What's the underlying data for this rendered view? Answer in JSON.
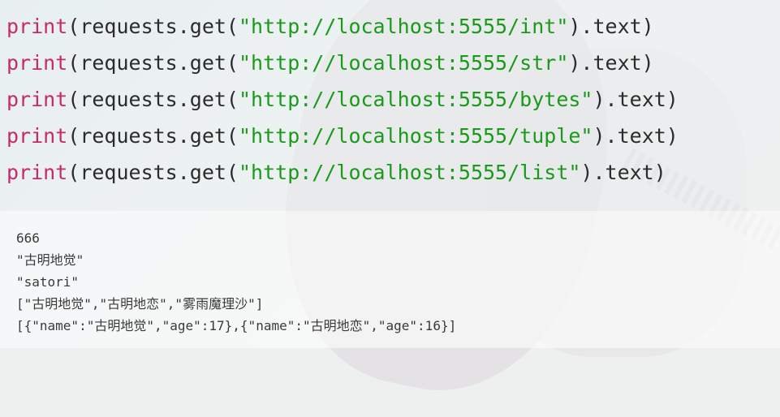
{
  "code": {
    "lines": [
      {
        "fn": "print",
        "pre": "(requests.get(",
        "url": "\"http://localhost:5555/int\"",
        "post": ").text)"
      },
      {
        "fn": "print",
        "pre": "(requests.get(",
        "url": "\"http://localhost:5555/str\"",
        "post": ").text)"
      },
      {
        "fn": "print",
        "pre": "(requests.get(",
        "url": "\"http://localhost:5555/bytes\"",
        "post": ").text)"
      },
      {
        "fn": "print",
        "pre": "(requests.get(",
        "url": "\"http://localhost:5555/tuple\"",
        "post": ").text)"
      },
      {
        "fn": "print",
        "pre": "(requests.get(",
        "url": "\"http://localhost:5555/list\"",
        "post": ").text)"
      }
    ]
  },
  "output": {
    "lines": [
      "666",
      "\"古明地觉\"",
      "\"satori\"",
      "[\"古明地觉\",\"古明地恋\",\"雾雨魔理沙\"]",
      "[{\"name\":\"古明地觉\",\"age\":17},{\"name\":\"古明地恋\",\"age\":16}]"
    ]
  },
  "colors": {
    "keyword": "#c72a6b",
    "string": "#1a9a1a",
    "text": "#2b2b2b"
  }
}
